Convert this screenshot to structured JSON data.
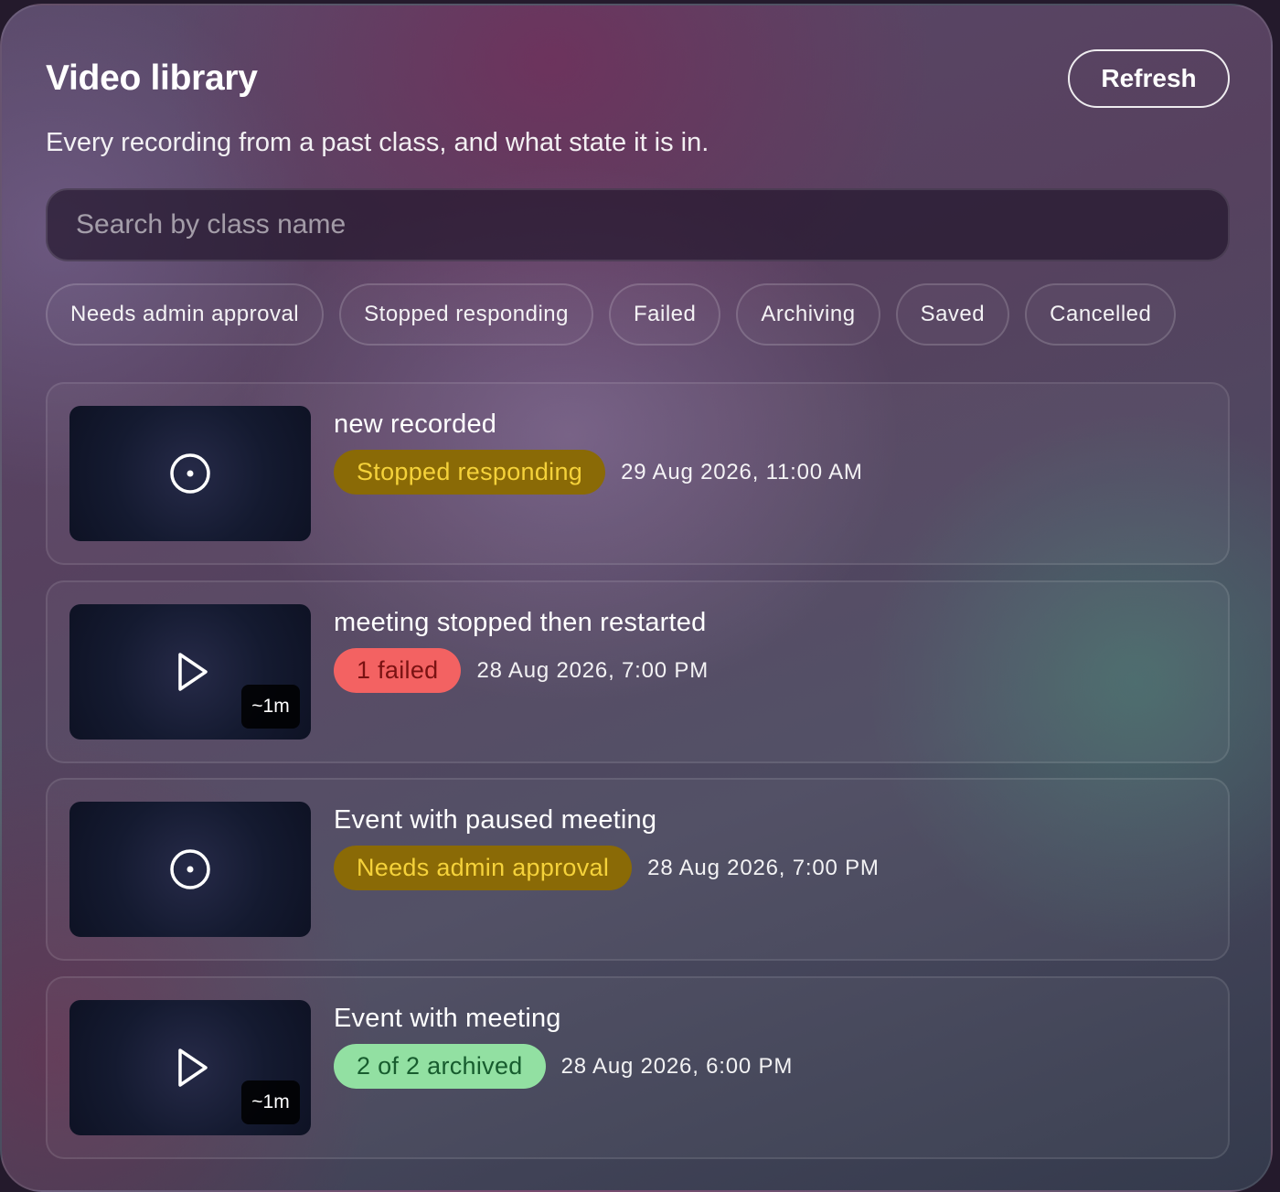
{
  "header": {
    "title": "Video library",
    "subtitle": "Every recording from a past class, and what state it is in.",
    "refresh_label": "Refresh"
  },
  "search": {
    "placeholder": "Search by class name",
    "value": ""
  },
  "filters": [
    {
      "label": "Needs admin approval"
    },
    {
      "label": "Stopped responding"
    },
    {
      "label": "Failed"
    },
    {
      "label": "Archiving"
    },
    {
      "label": "Saved"
    },
    {
      "label": "Cancelled"
    }
  ],
  "recordings": [
    {
      "title": "new recorded",
      "status": "Stopped responding",
      "status_kind": "warn",
      "date": "29 Aug 2026, 11:00 AM",
      "thumb_icon": "record-icon",
      "duration": ""
    },
    {
      "title": "meeting stopped then restarted",
      "status": "1 failed",
      "status_kind": "fail",
      "date": "28 Aug 2026, 7:00 PM",
      "thumb_icon": "play-icon",
      "duration": "~1m"
    },
    {
      "title": "Event with paused meeting",
      "status": "Needs admin approval",
      "status_kind": "warn",
      "date": "28 Aug 2026, 7:00 PM",
      "thumb_icon": "record-icon",
      "duration": ""
    },
    {
      "title": "Event with meeting",
      "status": "2 of 2 archived",
      "status_kind": "ok",
      "date": "28 Aug 2026, 6:00 PM",
      "thumb_icon": "play-icon",
      "duration": "~1m"
    }
  ],
  "colors": {
    "warn_bg": "#8a6a06",
    "warn_text": "#f5d23a",
    "fail_bg": "#f36262",
    "fail_text": "#7a1212",
    "ok_bg": "#92e0a2",
    "ok_text": "#175c2e"
  }
}
